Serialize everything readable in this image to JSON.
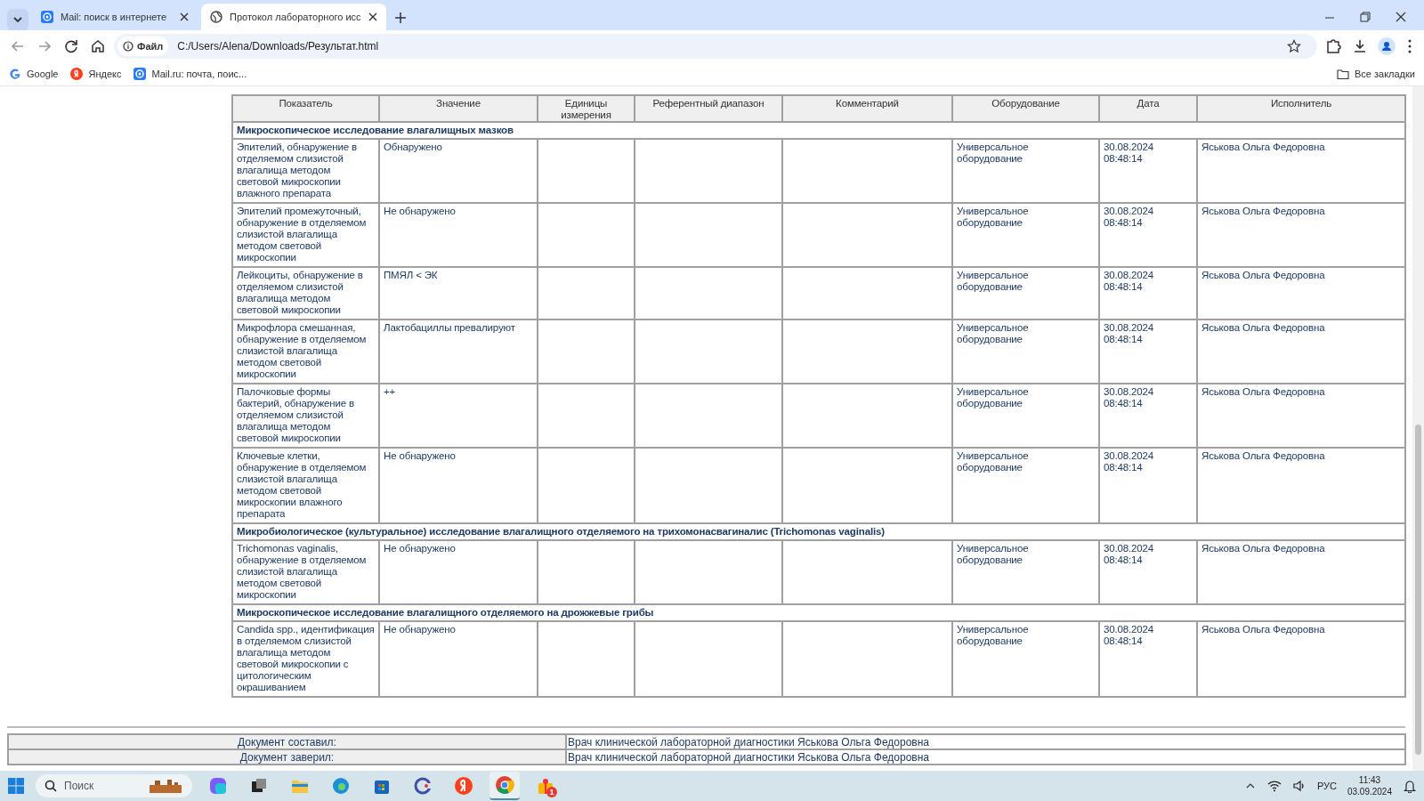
{
  "browser": {
    "tabs": [
      {
        "title": "Mail: поиск в интернете",
        "kind": "mail",
        "selected": false
      },
      {
        "title": "Протокол лабораторного исс",
        "kind": "globe",
        "selected": true
      }
    ],
    "address_bar": {
      "scheme_label": "Файл",
      "url": "C:/Users/Alena/Downloads/Результат.html"
    },
    "bookmarks": [
      {
        "label": "Google",
        "kind": "google"
      },
      {
        "label": "Яндекс",
        "kind": "yandex"
      },
      {
        "label": "Mail.ru: почта, поис...",
        "kind": "mail"
      }
    ],
    "all_bookmarks": "Все закладки"
  },
  "table": {
    "columns": [
      "Показатель",
      "Значение",
      "Единицы измерения",
      "Референтный диапазон",
      "Комментарий",
      "Оборудование",
      "Дата",
      "Исполнитель"
    ],
    "sections": [
      {
        "title": "Микроскопическое исследование влагалищных мазков",
        "rows": [
          {
            "indicator": "Эпителий, обнаружение в отделяемом слизистой влагалища методом световой микроскопии влажного препарата",
            "value": "Обнаружено",
            "equipment": "Универсальное оборудование",
            "date": "30.08.2024 08:48:14",
            "performer": "Яськова Ольга Федоровна"
          },
          {
            "indicator": "Эпителий промежуточный, обнаружение в отделяемом слизистой влагалища методом световой микроскопии",
            "value": "Не обнаружено",
            "equipment": "Универсальное оборудование",
            "date": "30.08.2024 08:48:14",
            "performer": "Яськова Ольга Федоровна"
          },
          {
            "indicator": "Лейкоциты, обнаружение в отделяемом слизистой влагалища методом световой микроскопии",
            "value": "ПМЯЛ < ЭК",
            "equipment": "Универсальное оборудование",
            "date": "30.08.2024 08:48:14",
            "performer": "Яськова Ольга Федоровна"
          },
          {
            "indicator": "Микрофлора смешанная, обнаружение в отделяемом слизистой влагалища методом световой микроскопии",
            "value": "Лактобациллы превалируют",
            "equipment": "Универсальное оборудование",
            "date": "30.08.2024 08:48:14",
            "performer": "Яськова Ольга Федоровна"
          },
          {
            "indicator": "Палочковые формы бактерий, обнаружение в отделяемом слизистой влагалища методом световой микроскопии",
            "value": "++",
            "equipment": "Универсальное оборудование",
            "date": "30.08.2024 08:48:14",
            "performer": "Яськова Ольга Федоровна"
          },
          {
            "indicator": "Ключевые клетки, обнаружение в отделяемом слизистой влагалища методом световой микроскопии влажного препарата",
            "value": "Не обнаружено",
            "equipment": "Универсальное оборудование",
            "date": "30.08.2024 08:48:14",
            "performer": "Яськова Ольга Федоровна"
          }
        ]
      },
      {
        "title": "Микробиологическое (культуральное) исследование влагалищного отделяемого на трихомонасвагиналис (Trichomonas vaginalis)",
        "rows": [
          {
            "indicator": "Trichomonas vaginalis, обнаружение в отделяемом слизистой влагалища методом световой микроскопии",
            "value": "Не обнаружено",
            "equipment": "Универсальное оборудование",
            "date": "30.08.2024 08:48:14",
            "performer": "Яськова Ольга Федоровна"
          }
        ]
      },
      {
        "title": "Микроскопическое исследование влагалищного отделяемого на дрожжевые грибы",
        "rows": [
          {
            "indicator": "Candida spp., идентификация в отделяемом слизистой влагалища методом световой микроскопии с цитологическим окрашиванием",
            "value": "Не обнаружено",
            "equipment": "Универсальное оборудование",
            "date": "30.08.2024 08:48:14",
            "performer": "Яськова Ольга Федоровна"
          }
        ]
      }
    ]
  },
  "signatures": [
    {
      "label": "Документ составил:",
      "value": "Врач клинической лабораторной диагностики Яськова Ольга Федоровна"
    },
    {
      "label": "Документ заверил:",
      "value": "Врач клинической лабораторной диагностики Яськова Ольга Федоровна"
    }
  ],
  "taskbar": {
    "search_placeholder": "Поиск",
    "notification_badge": "1",
    "language": "РУС",
    "time": "11:43",
    "date": "03.09.2024"
  }
}
